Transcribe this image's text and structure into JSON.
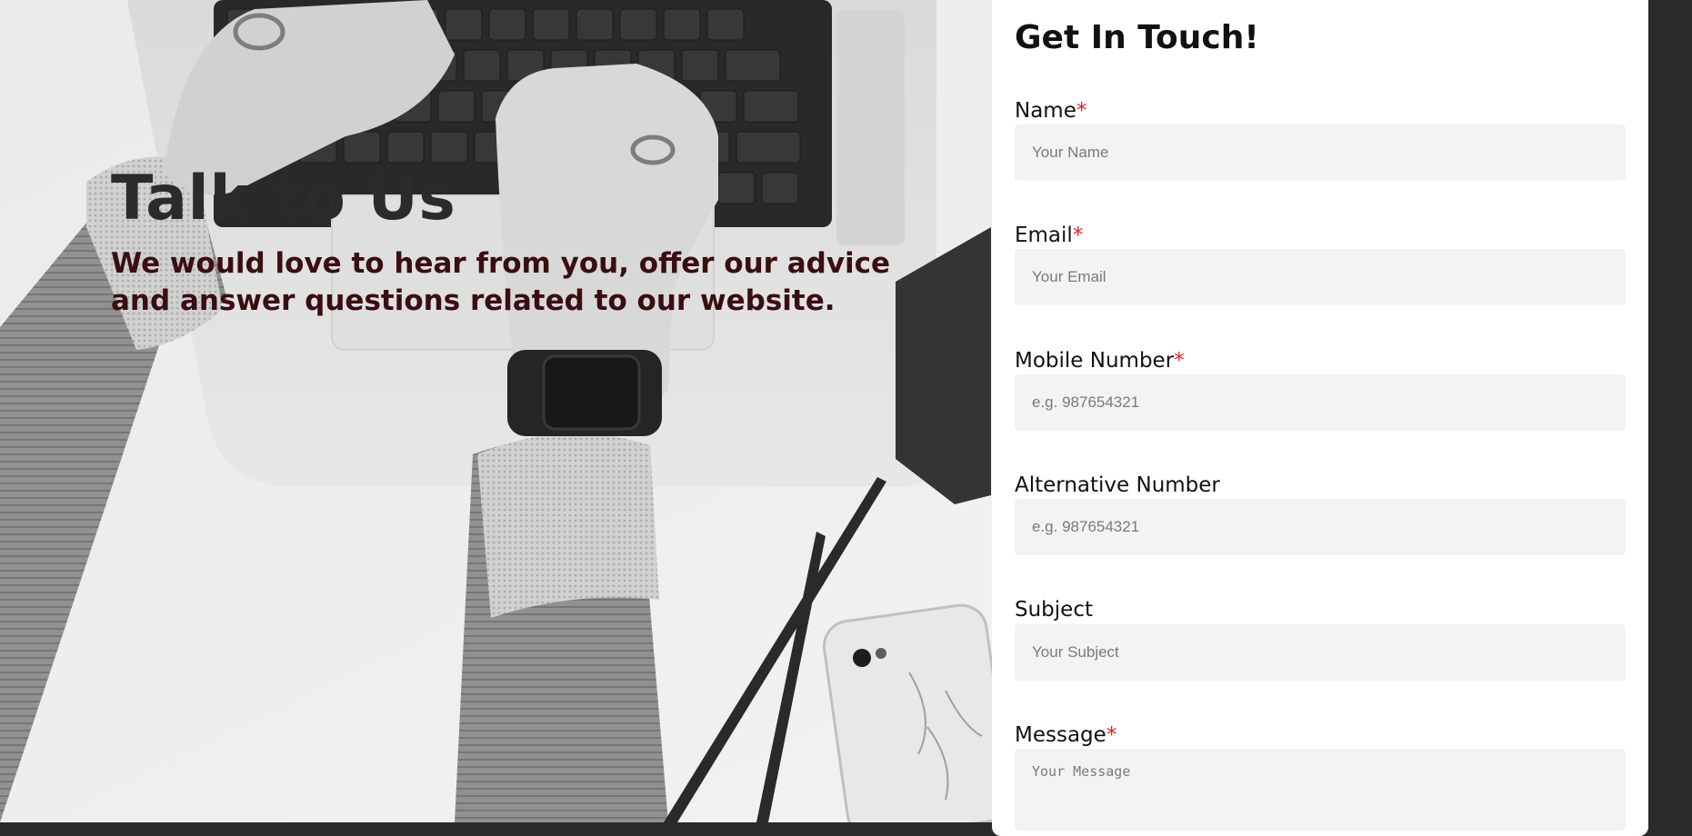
{
  "hero": {
    "title": "Talk to Us",
    "subtitle": "We would love to hear from you, offer our advice and answer questions related to our website."
  },
  "form": {
    "title": "Get In Touch!",
    "required_marker": "*",
    "fields": [
      {
        "label": "Name",
        "required": true,
        "placeholder": "Your Name"
      },
      {
        "label": "Email",
        "required": true,
        "placeholder": "Your Email"
      },
      {
        "label": "Mobile Number",
        "required": true,
        "placeholder": "e.g. 987654321"
      },
      {
        "label": "Alternative Number",
        "required": false,
        "placeholder": "e.g. 987654321"
      },
      {
        "label": "Subject",
        "required": false,
        "placeholder": "Your Subject"
      },
      {
        "label": "Message",
        "required": true,
        "placeholder": "Your Message"
      }
    ]
  },
  "colors": {
    "required_marker": "#e02020",
    "subtitle": "#3a0d12",
    "input_background": "#f3f3f3"
  }
}
